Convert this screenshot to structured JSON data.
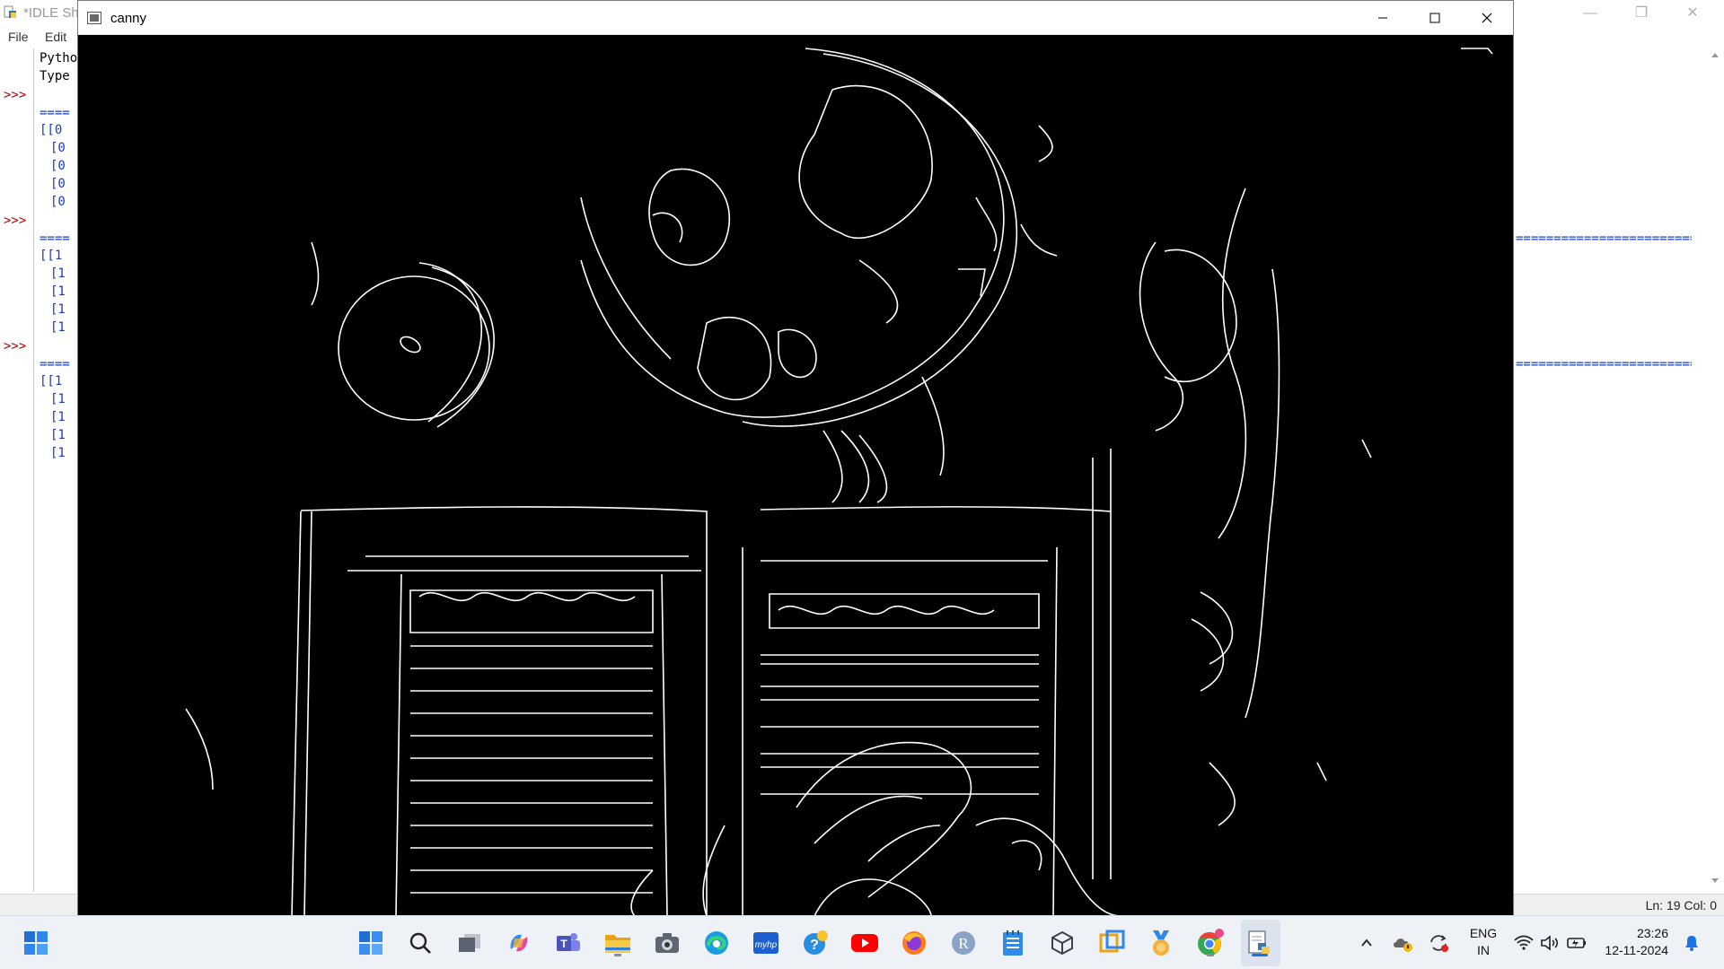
{
  "idle": {
    "title": "*IDLE She",
    "menu": [
      "File",
      "Edit"
    ],
    "prompts": [
      ">>>",
      ">>>",
      ">>>"
    ],
    "banner": [
      "Pytho",
      "Type"
    ],
    "separator": "====",
    "outputs": [
      [
        "[[0",
        "[0",
        "[0",
        "[0",
        "[0"
      ],
      [
        "[[1",
        "[1",
        "[1",
        "[1",
        "[1"
      ],
      [
        "[[1",
        "[1",
        "[1",
        "[1",
        "[1"
      ]
    ],
    "right_separator": "=====================================================================",
    "status": "Ln: 19   Col: 0",
    "controls": {
      "minimize": "—",
      "restore": "❐",
      "close": "✕"
    }
  },
  "canny": {
    "title": "canny",
    "icon": "app-window-icon",
    "buttons": [
      "minimize-icon",
      "maximize-icon",
      "close-icon"
    ]
  },
  "taskbar": {
    "apps": [
      {
        "name": "start",
        "icon": "windows-start-icon"
      },
      {
        "name": "search",
        "icon": "search-icon"
      },
      {
        "name": "task-view",
        "icon": "task-view-icon"
      },
      {
        "name": "copilot",
        "icon": "copilot-icon"
      },
      {
        "name": "teams",
        "icon": "teams-icon"
      },
      {
        "name": "file-explorer",
        "icon": "folder-icon"
      },
      {
        "name": "camera",
        "icon": "camera-icon"
      },
      {
        "name": "edge",
        "icon": "edge-icon"
      },
      {
        "name": "myhp",
        "icon": "myhp-icon"
      },
      {
        "name": "help",
        "icon": "help-icon"
      },
      {
        "name": "youtube",
        "icon": "youtube-icon"
      },
      {
        "name": "firefox",
        "icon": "firefox-icon"
      },
      {
        "name": "r",
        "icon": "r-icon"
      },
      {
        "name": "notepad",
        "icon": "notepad-icon"
      },
      {
        "name": "3d-viewer",
        "icon": "cube-icon"
      },
      {
        "name": "snip",
        "icon": "snip-icon"
      },
      {
        "name": "medal",
        "icon": "medal-icon"
      },
      {
        "name": "chrome",
        "icon": "chrome-icon"
      },
      {
        "name": "idle",
        "icon": "python-idle-icon"
      }
    ],
    "myhp_label": "myhp",
    "r_label": "R",
    "lang_top": "ENG",
    "lang_bottom": "IN",
    "time": "23:26",
    "date": "12-11-2024"
  },
  "colors": {
    "taskbar_bg": "#eef1f6",
    "canny_bg": "#000000",
    "edge_color": "#ffffff",
    "prompt_color": "#b00000",
    "output_color": "#1a3cbf"
  }
}
